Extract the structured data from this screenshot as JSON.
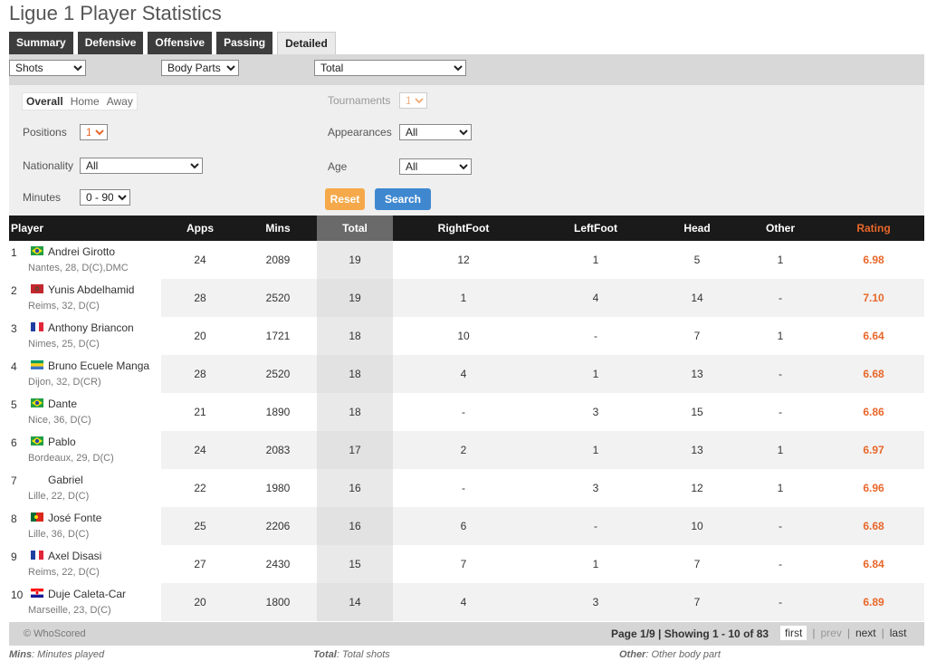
{
  "page_title": "Ligue 1 Player Statistics",
  "tabs": [
    {
      "label": "Summary",
      "active": false
    },
    {
      "label": "Defensive",
      "active": false
    },
    {
      "label": "Offensive",
      "active": false
    },
    {
      "label": "Passing",
      "active": false
    },
    {
      "label": "Detailed",
      "active": true
    }
  ],
  "selects": {
    "category": "Shots",
    "subcategory": "Body Parts",
    "type": "Total"
  },
  "filters": {
    "venue": [
      "Overall",
      "Home",
      "Away"
    ],
    "venue_selected": "Overall",
    "tournaments_label": "Tournaments",
    "tournaments_value": "1",
    "positions_label": "Positions",
    "positions_value": "1",
    "appearances_label": "Appearances",
    "appearances_value": "All",
    "nationality_label": "Nationality",
    "nationality_value": "All",
    "age_label": "Age",
    "age_value": "All",
    "minutes_label": "Minutes",
    "minutes_value": "0 - 90",
    "reset_label": "Reset",
    "search_label": "Search"
  },
  "columns": {
    "player": "Player",
    "apps": "Apps",
    "mins": "Mins",
    "total": "Total",
    "rightfoot": "RightFoot",
    "leftfoot": "LeftFoot",
    "head": "Head",
    "other": "Other",
    "rating": "Rating"
  },
  "rows": [
    {
      "rank": "1",
      "flag": "brazil",
      "name": "Andrei Girotto",
      "meta": "Nantes,  28, D(C),DMC",
      "apps": "24",
      "mins": "2089",
      "total": "19",
      "rightfoot": "12",
      "leftfoot": "1",
      "head": "5",
      "other": "1",
      "rating": "6.98"
    },
    {
      "rank": "2",
      "flag": "morocco",
      "name": "Yunis Abdelhamid",
      "meta": "Reims,  32, D(C)",
      "apps": "28",
      "mins": "2520",
      "total": "19",
      "rightfoot": "1",
      "leftfoot": "4",
      "head": "14",
      "other": "-",
      "rating": "7.10"
    },
    {
      "rank": "3",
      "flag": "france",
      "name": "Anthony Briancon",
      "meta": "Nimes,  25, D(C)",
      "apps": "20",
      "mins": "1721",
      "total": "18",
      "rightfoot": "10",
      "leftfoot": "-",
      "head": "7",
      "other": "1",
      "rating": "6.64"
    },
    {
      "rank": "4",
      "flag": "gabon",
      "name": "Bruno Ecuele Manga",
      "meta": "Dijon,  32, D(CR)",
      "apps": "28",
      "mins": "2520",
      "total": "18",
      "rightfoot": "4",
      "leftfoot": "1",
      "head": "13",
      "other": "-",
      "rating": "6.68"
    },
    {
      "rank": "5",
      "flag": "brazil",
      "name": "Dante",
      "meta": "Nice,  36, D(C)",
      "apps": "21",
      "mins": "1890",
      "total": "18",
      "rightfoot": "-",
      "leftfoot": "3",
      "head": "15",
      "other": "-",
      "rating": "6.86"
    },
    {
      "rank": "6",
      "flag": "brazil",
      "name": "Pablo",
      "meta": "Bordeaux,  29, D(C)",
      "apps": "24",
      "mins": "2083",
      "total": "17",
      "rightfoot": "2",
      "leftfoot": "1",
      "head": "13",
      "other": "1",
      "rating": "6.97"
    },
    {
      "rank": "7",
      "flag": "none",
      "name": "Gabriel",
      "meta": "Lille,  22, D(C)",
      "apps": "22",
      "mins": "1980",
      "total": "16",
      "rightfoot": "-",
      "leftfoot": "3",
      "head": "12",
      "other": "1",
      "rating": "6.96"
    },
    {
      "rank": "8",
      "flag": "portugal",
      "name": "José Fonte",
      "meta": "Lille,  36, D(C)",
      "apps": "25",
      "mins": "2206",
      "total": "16",
      "rightfoot": "6",
      "leftfoot": "-",
      "head": "10",
      "other": "-",
      "rating": "6.68"
    },
    {
      "rank": "9",
      "flag": "france",
      "name": "Axel Disasi",
      "meta": "Reims,  22, D(C)",
      "apps": "27",
      "mins": "2430",
      "total": "15",
      "rightfoot": "7",
      "leftfoot": "1",
      "head": "7",
      "other": "-",
      "rating": "6.84"
    },
    {
      "rank": "10",
      "flag": "croatia",
      "name": "Duje Caleta-Car",
      "meta": "Marseille,  23, D(C)",
      "apps": "20",
      "mins": "1800",
      "total": "14",
      "rightfoot": "4",
      "leftfoot": "3",
      "head": "7",
      "other": "-",
      "rating": "6.89"
    }
  ],
  "footer": {
    "copyright": "© WhoScored",
    "page_info": "Page 1/9 | Showing 1 - 10 of 83",
    "first": "first",
    "prev": "prev",
    "next": "next",
    "last": "last",
    "sep": "|"
  },
  "legend": {
    "mins_key": "Mins",
    "mins_text": ": Minutes played",
    "total_key": "Total",
    "total_text": ": Total shots",
    "other_key": "Other",
    "other_text": ": Other body part"
  },
  "colors": {
    "header_bg": "#1a1a1a",
    "rating": "#e8672a",
    "reset": "#f5a94a",
    "search": "#3f88d0"
  }
}
